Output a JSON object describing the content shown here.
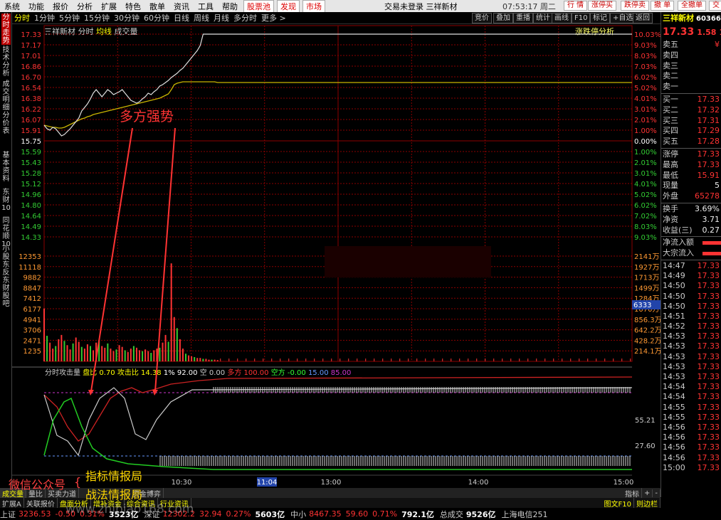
{
  "menu": {
    "items": [
      "系统",
      "功能",
      "报价",
      "分析",
      "扩展",
      "特色",
      "散单",
      "资讯",
      "工具",
      "帮助"
    ],
    "highlight_items": [
      "股票池",
      "发现",
      "市场"
    ],
    "center_text": "交易未登录  三祥新材",
    "clock": "07:53:17 周二",
    "top_buttons": [
      "行 情",
      "涨停买",
      "跌停卖",
      "撤 单",
      "全撤单",
      "交"
    ]
  },
  "left_tabs": [
    "分时走势",
    "技术分析",
    "成交明细",
    "分价表",
    "基本资料",
    "东财10",
    "同花顺10",
    "小股东反",
    "东财股吧"
  ],
  "period": {
    "items": [
      "分时",
      "1分钟",
      "5分钟",
      "15分钟",
      "30分钟",
      "60分钟",
      "日线",
      "周线",
      "月线",
      "多分时",
      "更多 >"
    ],
    "active": "分时",
    "right_buttons": [
      "竞价",
      "叠加",
      "重播",
      "统计",
      "画线",
      "F10",
      "标记",
      "+自选",
      "返回"
    ]
  },
  "stock": {
    "name": "三祥新材",
    "mode": "分时",
    "avg_label": "均线",
    "vol_label": "成交量",
    "analysis_label": "涨跌停分析"
  },
  "chart_data": {
    "type": "line",
    "price_axis_left": [
      "17.33",
      "17.17",
      "17.01",
      "16.86",
      "16.70",
      "16.54",
      "16.38",
      "16.22",
      "16.07",
      "15.91",
      "15.75",
      "15.59",
      "15.43",
      "15.28",
      "15.12",
      "14.96",
      "14.80",
      "14.64",
      "14.49",
      "14.33"
    ],
    "price_axis_right": [
      "10.03%",
      "9.03%",
      "8.03%",
      "7.03%",
      "6.02%",
      "5.02%",
      "4.01%",
      "3.01%",
      "2.01%",
      "1.00%",
      "0.00%",
      "1.00%",
      "2.01%",
      "3.01%",
      "4.01%",
      "5.02%",
      "6.02%",
      "7.02%",
      "8.03%",
      "9.03%"
    ],
    "price_axis_right_pos": [
      true,
      true,
      true,
      true,
      true,
      true,
      true,
      true,
      true,
      true,
      false,
      false,
      false,
      false,
      false,
      false,
      false,
      false,
      false,
      false
    ],
    "volume_axis_left": [
      "12353",
      "11118",
      "9882",
      "8847",
      "7412",
      "6177",
      "4941",
      "3706",
      "2471",
      "1235"
    ],
    "volume_axis_right": [
      "2141万",
      "1927万",
      "1713万",
      "1499万",
      "1284万",
      "1070万",
      "856.3万",
      "642.2万",
      "428.2万",
      "214.1万"
    ],
    "volume_cursor_label": "6333",
    "prev_close": 15.75,
    "ylim": [
      14.33,
      17.33
    ],
    "price": [
      16.05,
      16.0,
      15.98,
      16.02,
      16.0,
      15.95,
      15.9,
      15.92,
      15.96,
      16.0,
      16.05,
      16.1,
      16.15,
      16.25,
      16.3,
      16.35,
      16.42,
      16.5,
      16.55,
      16.5,
      16.45,
      16.5,
      16.55,
      16.52,
      16.48,
      16.5,
      16.52,
      16.55,
      16.5,
      16.45,
      16.4,
      16.38,
      16.36,
      16.38,
      16.42,
      16.45,
      16.5,
      16.48,
      16.52,
      16.55,
      16.6,
      16.62,
      16.65,
      16.68,
      16.72,
      16.75,
      16.78,
      16.82,
      16.85,
      16.9,
      16.95,
      17.0,
      17.05,
      17.1,
      17.17,
      17.33,
      17.33,
      17.33,
      17.33,
      17.33,
      17.33
    ],
    "avg": [
      16.05,
      16.04,
      16.03,
      16.02,
      16.02,
      16.01,
      16.01,
      16.02,
      16.04,
      16.06,
      16.08,
      16.1,
      16.12,
      16.14,
      16.15,
      16.17,
      16.18,
      16.2,
      16.21,
      16.22,
      16.23,
      16.24,
      16.25,
      16.26,
      16.27,
      16.28,
      16.29,
      16.3,
      16.31,
      16.32,
      16.33,
      16.34,
      16.35,
      16.36,
      16.37,
      16.38,
      16.39,
      16.4,
      16.41,
      16.42,
      16.43,
      16.45,
      16.47,
      16.49,
      16.55,
      16.62,
      16.64,
      16.65,
      16.66,
      16.66,
      16.66,
      16.66,
      16.66,
      16.66,
      16.66,
      16.66,
      16.66,
      16.66,
      16.66,
      16.66,
      16.65
    ],
    "volume": [
      6200,
      3000,
      2200,
      1500,
      1800,
      2600,
      3100,
      2400,
      1900,
      1400,
      2100,
      2800,
      2300,
      1700,
      1500,
      2000,
      1800,
      1300,
      2200,
      2500,
      1800,
      1600,
      2100,
      1500,
      1200,
      1400,
      1900,
      1700,
      1300,
      1100,
      1500,
      1800,
      1600,
      1300,
      1200,
      1400,
      1200,
      1000,
      1300,
      1500,
      1600,
      2200,
      3100,
      2300,
      11500,
      5200,
      3900,
      2600,
      1500,
      900,
      700,
      600,
      500,
      400,
      400,
      300,
      300,
      200,
      200,
      200,
      150
    ],
    "time_labels": [
      "10:30",
      "11:04",
      "13:00",
      "14:00",
      "15:00"
    ],
    "time_cursor": "11:04"
  },
  "indicator": {
    "name": "分时攻击量",
    "items": [
      {
        "label": "盘比",
        "value": "0.70",
        "color": "#ffff00"
      },
      {
        "label": "攻击比",
        "value": "14.38",
        "color": "#ffff00"
      },
      {
        "label": "1%",
        "value": "92.00",
        "color": "#ffffff"
      },
      {
        "label": "空",
        "value": "0.00",
        "color": "#cccccc"
      },
      {
        "label": "多方",
        "value": "100.00",
        "color": "#ff3333"
      },
      {
        "label": "空方",
        "value": "-0.00",
        "color": "#33ff33"
      },
      {
        "label": "",
        "value": "15.00",
        "color": "#6699ff"
      },
      {
        "label": "",
        "value": "85.00",
        "color": "#cc33cc"
      }
    ],
    "axis": [
      "55.21",
      "27.60"
    ]
  },
  "annotation": {
    "text": "多方强势",
    "color": "#ff3333"
  },
  "watermarks": {
    "wechat": "微信公众号",
    "brace": "{",
    "line1": "指标情报局",
    "line2": "战法情报局",
    "site": "www.zhibiao168.com"
  },
  "right_panel": {
    "title": "三祥新材",
    "code": "603663",
    "price": "17.33",
    "change": "1.58",
    "pct": "10.03%",
    "order_book": [
      {
        "label": "卖五",
        "value": "¥"
      },
      {
        "label": "卖四",
        "value": ""
      },
      {
        "label": "卖三",
        "value": ""
      },
      {
        "label": "卖二",
        "value": ""
      },
      {
        "label": "卖一",
        "value": ""
      },
      {
        "label": "买一",
        "value": "17.33"
      },
      {
        "label": "买二",
        "value": "17.32"
      },
      {
        "label": "买三",
        "value": "17.31"
      },
      {
        "label": "买四",
        "value": "17.29"
      },
      {
        "label": "买五",
        "value": "17.28"
      }
    ],
    "stats": [
      {
        "label": "涨停",
        "value": "17.33",
        "white": false
      },
      {
        "label": "最高",
        "value": "17.33",
        "white": false
      },
      {
        "label": "最低",
        "value": "15.91",
        "white": false
      },
      {
        "label": "现量",
        "value": "5",
        "white": true
      },
      {
        "label": "外盘",
        "value": "65278",
        "white": false
      },
      {
        "label": "换手",
        "value": "3.69%",
        "white": true
      },
      {
        "label": "净资",
        "value": "3.71",
        "white": true
      },
      {
        "label": "收益(三)",
        "value": "0.27",
        "white": true
      }
    ],
    "flows": [
      "净流入额",
      "大宗流入"
    ],
    "ticks": [
      {
        "t": "14:47",
        "v": "17.33"
      },
      {
        "t": "14:49",
        "v": "17.33"
      },
      {
        "t": "14:50",
        "v": "17.33"
      },
      {
        "t": "14:50",
        "v": "17.33"
      },
      {
        "t": "14:50",
        "v": "17.33"
      },
      {
        "t": "14:51",
        "v": "17.33"
      },
      {
        "t": "14:52",
        "v": "17.33"
      },
      {
        "t": "14:53",
        "v": "17.33"
      },
      {
        "t": "14:53",
        "v": "17.33"
      },
      {
        "t": "14:53",
        "v": "17.33"
      },
      {
        "t": "14:53",
        "v": "17.33"
      },
      {
        "t": "14:53",
        "v": "17.33"
      },
      {
        "t": "14:54",
        "v": "17.33"
      },
      {
        "t": "14:54",
        "v": "17.33"
      },
      {
        "t": "14:55",
        "v": "17.33"
      },
      {
        "t": "14:55",
        "v": "17.33"
      },
      {
        "t": "14:56",
        "v": "17.33"
      },
      {
        "t": "14:56",
        "v": "17.33"
      },
      {
        "t": "14:56",
        "v": "17.33"
      },
      {
        "t": "14:56",
        "v": "17.33"
      },
      {
        "t": "15:00",
        "v": "17.33"
      }
    ]
  },
  "bottom_tabs": [
    "成交量",
    "量比",
    "买卖力道",
    "",
    "",
    "",
    "",
    "资金博弈"
  ],
  "bottom_right": [
    "指标",
    "+",
    "-"
  ],
  "sub_tabs": [
    "扩展A",
    "关联报价",
    "盘面分析",
    "增补资金",
    "综合资讯",
    "行业资讯"
  ],
  "sub_right": [
    "图文F10",
    "则边栏"
  ],
  "status_bar": {
    "sh_label": "上证",
    "sh_value": "3236.53",
    "sh_chg": "-0.50",
    "sh_pct": "0.31%",
    "sh_amt": "3523亿",
    "sz_label": "深证",
    "sz_value": "12302.2",
    "sz_chg": "32.94",
    "sz_pct": "0.27%",
    "sz_amt": "5603亿",
    "zx_label": "中小",
    "zx_value": "8467.35",
    "zx_chg": "59.60",
    "zx_pct": "0.71%",
    "zx_amt": "792.1亿",
    "total_label": "总成交",
    "total_amt": "9526亿",
    "last": "上海电信251"
  },
  "colors": {
    "up": "#ff3333",
    "down": "#33ff33",
    "avg_line": "#c8b400",
    "price_line": "#e0e0e0",
    "grid": "#8b0000"
  }
}
